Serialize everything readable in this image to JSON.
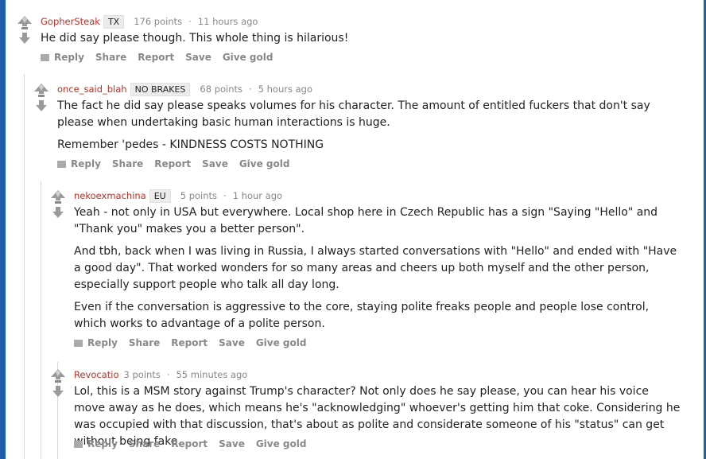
{
  "comments": [
    {
      "author": "GopherSteak",
      "flair": "TX",
      "points": "176 points",
      "age": "11 hours ago",
      "body": [
        "He did say please though. This whole thing is hilarious!"
      ],
      "actions": {
        "reply": "Reply",
        "share": "Share",
        "report": "Report",
        "save": "Save",
        "gold": "Give gold"
      }
    },
    {
      "author": "once_said_blah",
      "flair": "NO BRAKES",
      "points": "68 points",
      "age": "5 hours ago",
      "body": [
        "The fact he did say please speaks volumes for his character. The amount of entitled fuckers that don't say please when undertaking basic human interactions is huge.",
        "Remember 'pedes - KINDNESS COSTS NOTHING"
      ],
      "actions": {
        "reply": "Reply",
        "share": "Share",
        "report": "Report",
        "save": "Save",
        "gold": "Give gold"
      }
    },
    {
      "author": "nekoexmachina",
      "flair": "EU",
      "points": "5 points",
      "age": "1 hour ago",
      "body": [
        "Yeah - not only in USA but everywhere. Local shop here in Czech Republic has a sign \"Saying \"Hello\" and \"Thank you\" makes you a better person\".",
        "And tbh, back when I was living in Russia, I always started conversations with \"Hello\" and ended with \"Have a good day\". That worked wonders for so many areas and cheers up both myself and the other person, especially support people who talk all day long.",
        "Even if the conversation is aggressive to the core, staying polite freaks people and people lose control, which works to advantage of a polite person."
      ],
      "actions": {
        "reply": "Reply",
        "share": "Share",
        "report": "Report",
        "save": "Save",
        "gold": "Give gold"
      }
    },
    {
      "author": "Revocatio",
      "flair": "",
      "points": "3 points",
      "age": "55 minutes ago",
      "body": [
        "Lol, this is a MSM story against Trump's character? Not only does he say please, you can hear his voice move away as he does, which means he's \"acknowledging\" whoever's getting him that coke. Considering he was occupied with that discussion, that's about as polite and considerate someone of his \"status\" can get without being fake."
      ],
      "actions": {
        "reply": "Reply",
        "share": "Share",
        "report": "Report",
        "save": "Save",
        "gold": "Give gold"
      }
    }
  ],
  "dot": "·",
  "colors": {
    "accent": "#1f5fa8",
    "author": "#c22f25",
    "muted": "#888888"
  }
}
